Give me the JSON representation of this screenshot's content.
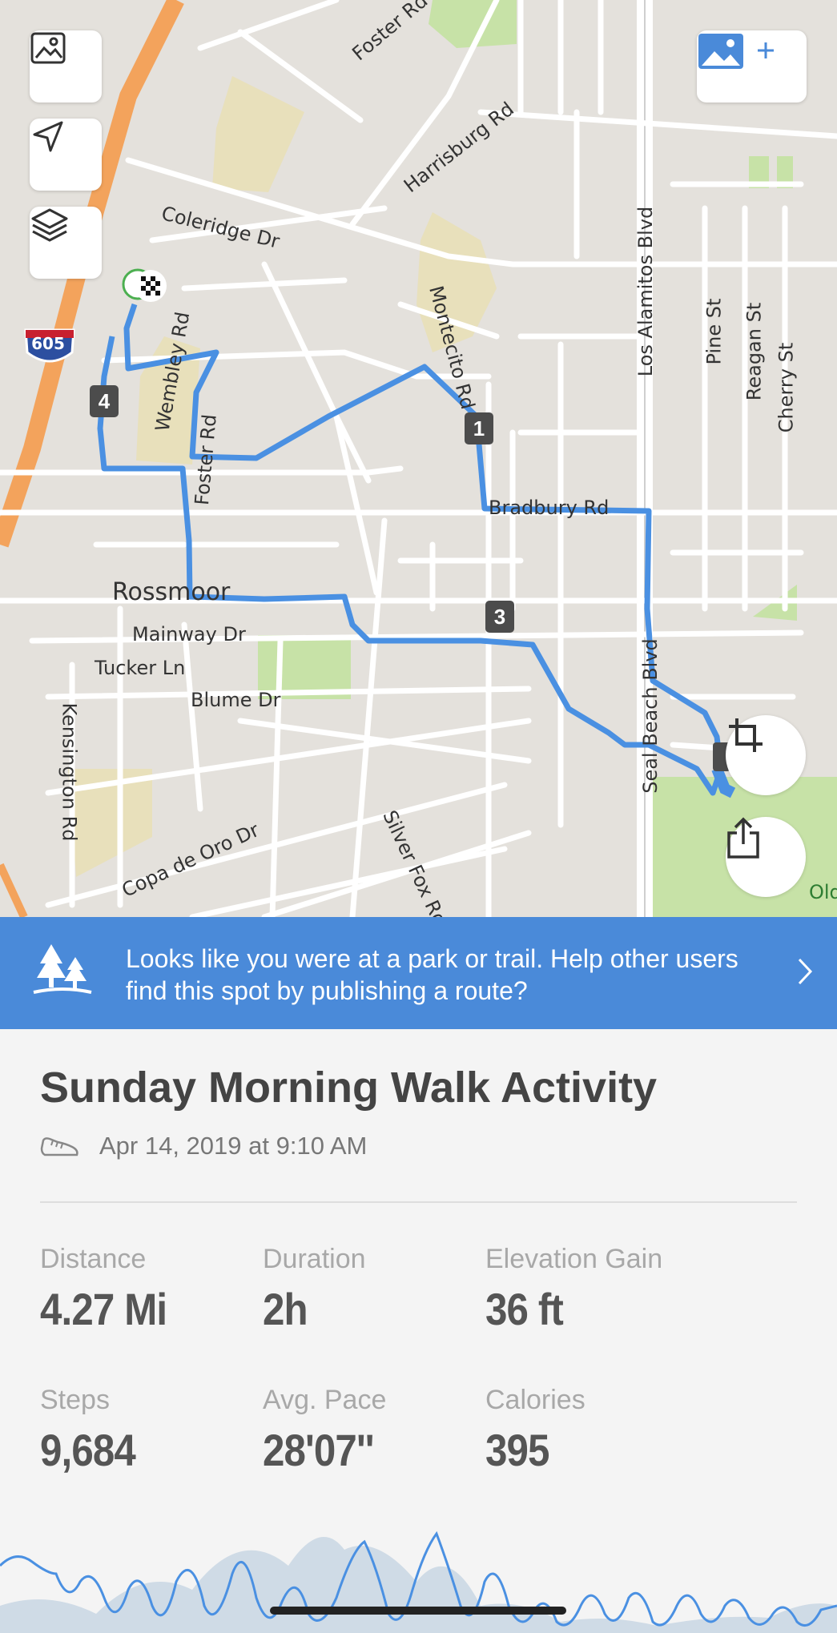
{
  "map": {
    "interstate_number": "605",
    "road_labels": {
      "foster_rd_top": "Foster Rd",
      "harrisburg": "Harrisburg Rd",
      "coleridge": "Coleridge Dr",
      "los_alamitos": "Los Alamitos Blvd",
      "pine": "Pine St",
      "reagan": "Reagan St",
      "cherry": "Cherry St",
      "montecito": "Montecito Rd",
      "bradbury": "Bradbury Rd",
      "wembley": "Wembley Rd",
      "foster_rd": "Foster Rd",
      "rossmoor": "Rossmoor",
      "mainway": "Mainway Dr",
      "tucker": "Tucker Ln",
      "blume": "Blume Dr",
      "kensington": "Kensington Rd",
      "seal_beach": "Seal Beach Blvd",
      "copa_de_oro": "Copa de Oro Dr",
      "silver_fox": "Silver Fox Rd",
      "old": "Old"
    },
    "markers": [
      "1",
      "3",
      "4"
    ],
    "route_color": "#4a90e2"
  },
  "banner": {
    "text": "Looks like you were at a park or trail. Help other users find this spot by publishing a route?",
    "color": "#4a8ad9"
  },
  "activity": {
    "title": "Sunday Morning Walk Activity",
    "date": "Apr 14, 2019 at 9:10 AM"
  },
  "stats": [
    {
      "label": "Distance",
      "value": "4.27 Mi"
    },
    {
      "label": "Duration",
      "value": "2h"
    },
    {
      "label": "Elevation Gain",
      "value": "36 ft"
    },
    {
      "label": "Steps",
      "value": "9,684"
    },
    {
      "label": "Avg. Pace",
      "value": "28'07''"
    },
    {
      "label": "Calories",
      "value": "395"
    }
  ]
}
